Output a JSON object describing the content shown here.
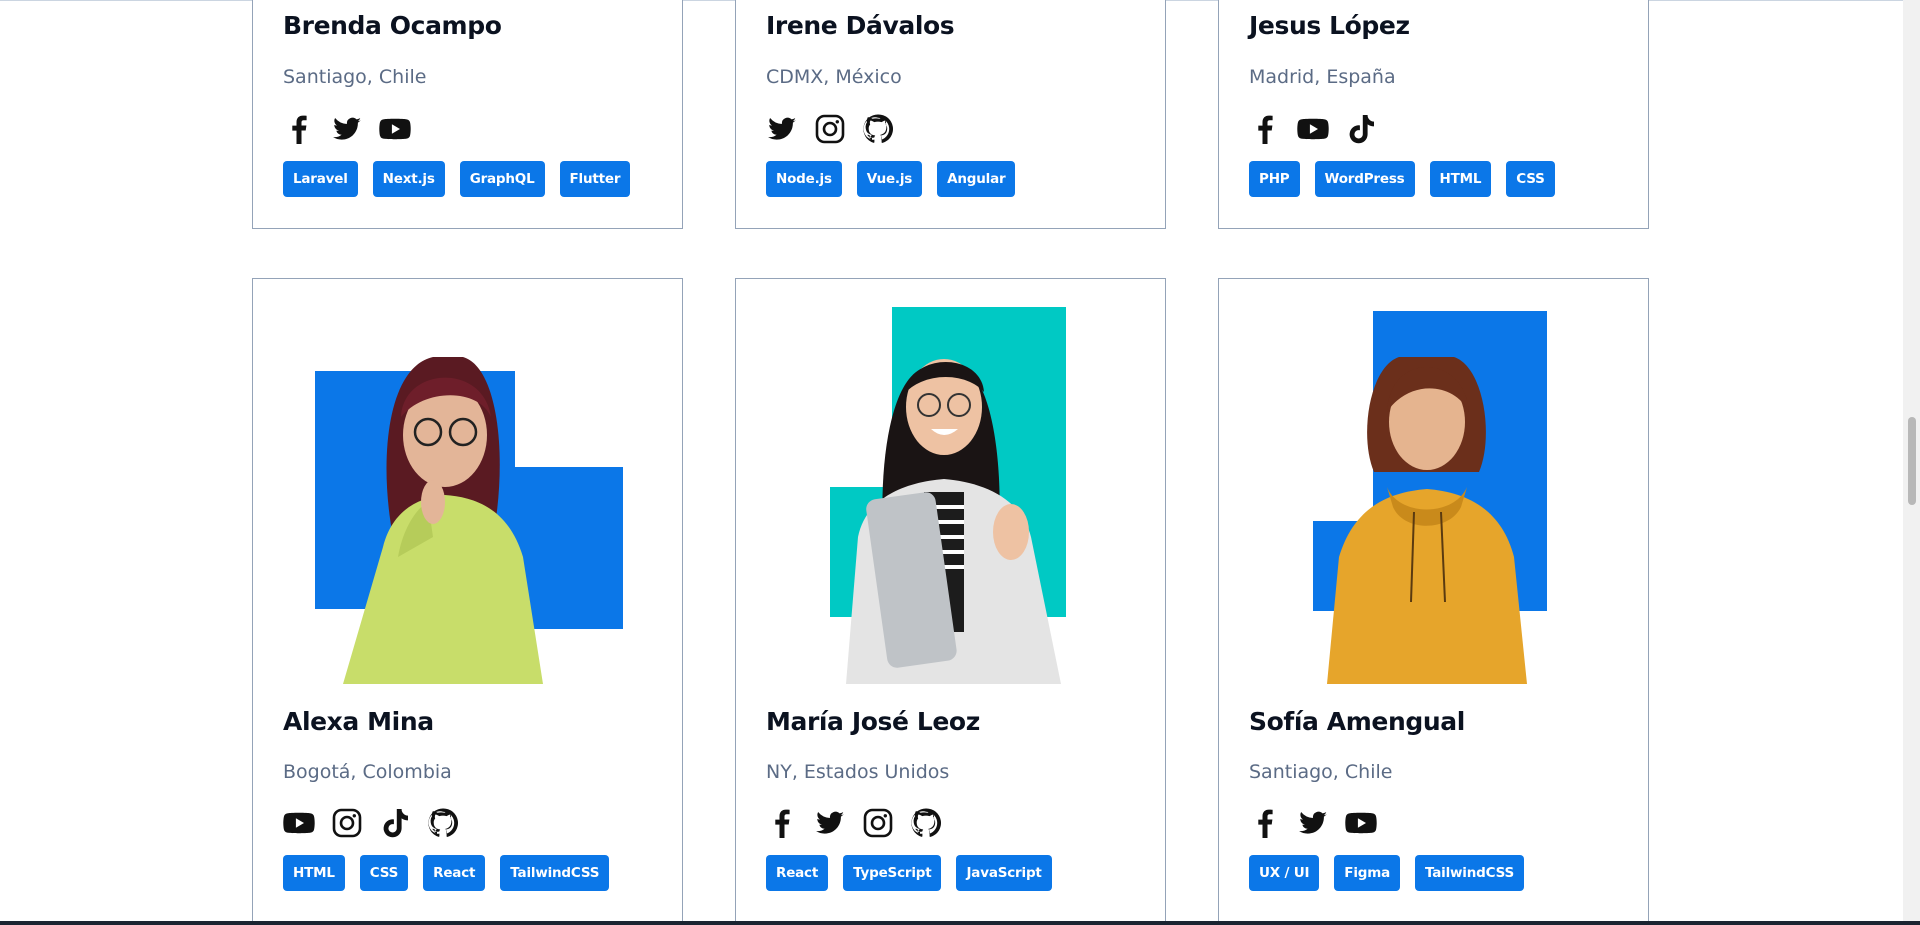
{
  "colors": {
    "accent": "#0b77e8",
    "teal_accent": "#00c9c4",
    "border": "#94a3b8",
    "location_text": "#5b6b85"
  },
  "cards_top": [
    {
      "name": "Brenda Ocampo",
      "location": "Santiago, Chile",
      "socials": [
        "facebook-icon",
        "twitter-icon",
        "youtube-icon"
      ],
      "tags": [
        "Laravel",
        "Next.js",
        "GraphQL",
        "Flutter"
      ]
    },
    {
      "name": "Irene Dávalos",
      "location": "CDMX, México",
      "socials": [
        "twitter-icon",
        "instagram-icon",
        "github-icon"
      ],
      "tags": [
        "Node.js",
        "Vue.js",
        "Angular"
      ]
    },
    {
      "name": "Jesus López",
      "location": "Madrid, España",
      "socials": [
        "facebook-icon",
        "youtube-icon",
        "tiktok-icon"
      ],
      "tags": [
        "PHP",
        "WordPress",
        "HTML",
        "CSS"
      ]
    }
  ],
  "cards_bottom": [
    {
      "name": "Alexa Mina",
      "location": "Bogotá, Colombia",
      "socials": [
        "youtube-icon",
        "instagram-icon",
        "tiktok-icon",
        "github-icon"
      ],
      "tags": [
        "HTML",
        "CSS",
        "React",
        "TailwindCSS"
      ],
      "photo_bg": "#0b77e8"
    },
    {
      "name": "María José Leoz",
      "location": "NY, Estados Unidos",
      "socials": [
        "facebook-icon",
        "twitter-icon",
        "instagram-icon",
        "github-icon"
      ],
      "tags": [
        "React",
        "TypeScript",
        "JavaScript"
      ],
      "photo_bg": "#00c9c4"
    },
    {
      "name": "Sofía Amengual",
      "location": "Santiago, Chile",
      "socials": [
        "facebook-icon",
        "twitter-icon",
        "youtube-icon"
      ],
      "tags": [
        "UX / UI",
        "Figma",
        "TailwindCSS"
      ],
      "photo_bg": "#0b77e8"
    }
  ]
}
